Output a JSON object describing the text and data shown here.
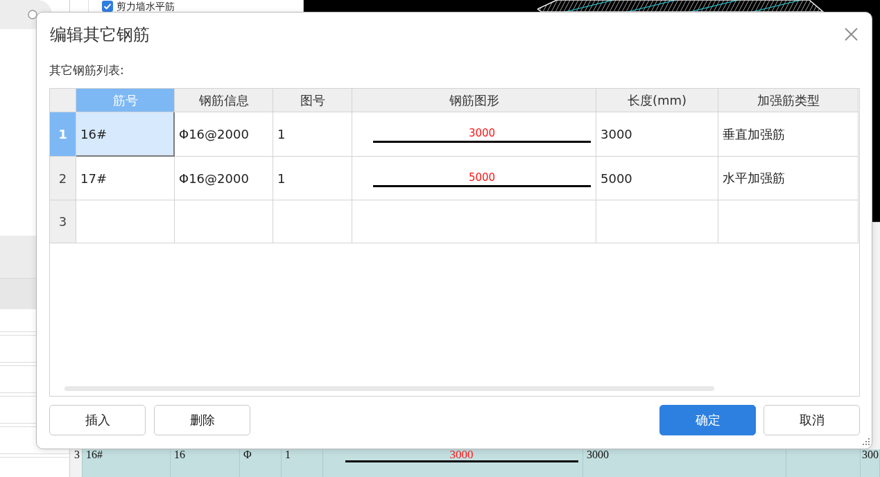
{
  "background": {
    "layer_item": {
      "label": "剪力墙水平筋",
      "checked": true
    },
    "bottom_row": {
      "number": "3",
      "cells": [
        {
          "kind": "text",
          "text": "16#"
        },
        {
          "kind": "text",
          "text": "16"
        },
        {
          "kind": "text",
          "text": "Φ"
        },
        {
          "kind": "text",
          "text": "1"
        },
        {
          "kind": "shape",
          "text": "3000"
        },
        {
          "kind": "text",
          "text": "3000"
        },
        {
          "kind": "empty"
        },
        {
          "kind": "text",
          "text": "300"
        }
      ]
    }
  },
  "dialog": {
    "title": "编辑其它钢筋",
    "list_label": "其它钢筋列表:",
    "table": {
      "columns": [
        {
          "label": "筋号",
          "kind": "text",
          "selected": true
        },
        {
          "label": "钢筋信息",
          "kind": "text",
          "selected": false
        },
        {
          "label": "图号",
          "kind": "text",
          "selected": false
        },
        {
          "label": "钢筋图形",
          "kind": "shape",
          "selected": false
        },
        {
          "label": "长度(mm)",
          "kind": "text",
          "selected": false
        },
        {
          "label": "加强筋类型",
          "kind": "text",
          "selected": false
        }
      ],
      "rows": [
        {
          "number": "1",
          "selected": true,
          "cells": [
            "16#",
            "Φ16@2000",
            "1",
            "3000",
            "3000",
            "垂直加强筋"
          ]
        },
        {
          "number": "2",
          "selected": false,
          "cells": [
            "17#",
            "Φ16@2000",
            "1",
            "5000",
            "5000",
            "水平加强筋"
          ]
        },
        {
          "number": "3",
          "selected": false
        }
      ]
    },
    "left_buttons": [
      {
        "label": "插入",
        "primary": false
      },
      {
        "label": "删除",
        "primary": false
      }
    ],
    "right_buttons": [
      {
        "label": "确定",
        "primary": true
      },
      {
        "label": "取消",
        "primary": false
      }
    ]
  }
}
